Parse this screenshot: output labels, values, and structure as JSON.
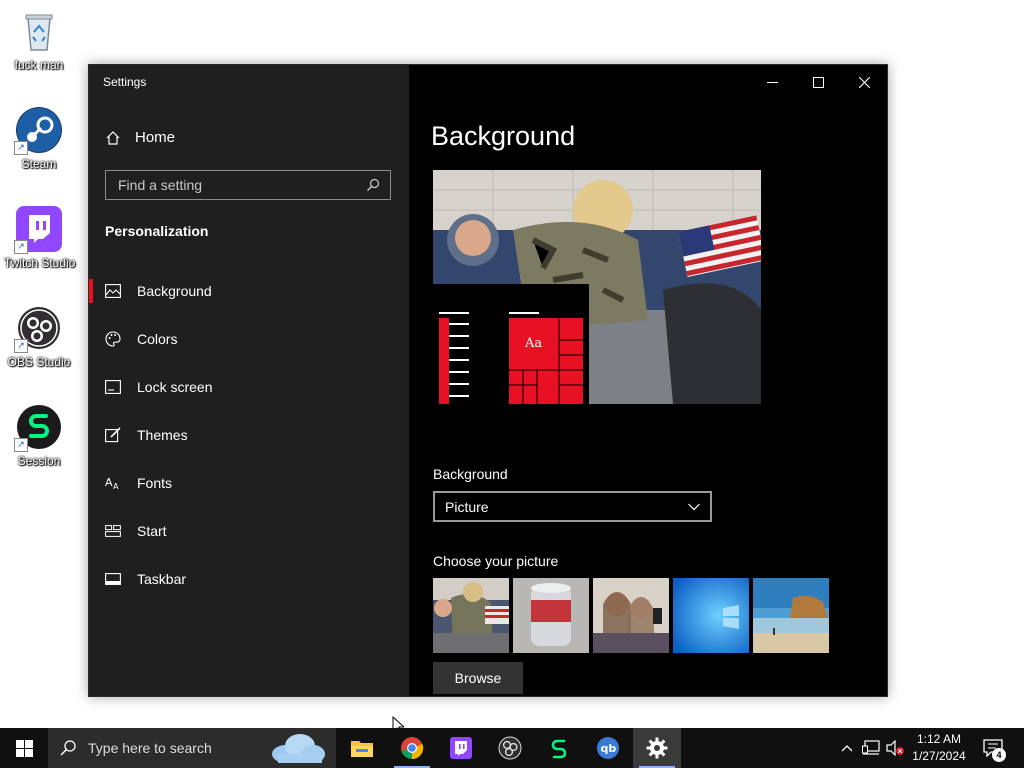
{
  "desktop": {
    "icons": [
      {
        "label": "fuck man",
        "icon": "recycle-bin-icon"
      },
      {
        "label": "Steam",
        "icon": "steam-icon"
      },
      {
        "label": "Twitch Studio",
        "icon": "twitch-studio-icon"
      },
      {
        "label": "OBS Studio",
        "icon": "obs-studio-icon"
      },
      {
        "label": "Session",
        "icon": "session-icon"
      }
    ]
  },
  "window": {
    "title": "Settings",
    "caption": {
      "minimize": "minimize-icon",
      "maximize": "maximize-icon",
      "close": "close-icon"
    }
  },
  "sidebar": {
    "home_label": "Home",
    "search_placeholder": "Find a setting",
    "section_title": "Personalization",
    "items": [
      {
        "label": "Background",
        "icon": "picture-icon",
        "active": true
      },
      {
        "label": "Colors",
        "icon": "palette-icon",
        "active": false
      },
      {
        "label": "Lock screen",
        "icon": "lock-screen-icon",
        "active": false
      },
      {
        "label": "Themes",
        "icon": "themes-icon",
        "active": false
      },
      {
        "label": "Fonts",
        "icon": "fonts-icon",
        "active": false
      },
      {
        "label": "Start",
        "icon": "start-icon",
        "active": false
      },
      {
        "label": "Taskbar",
        "icon": "taskbar-icon",
        "active": false
      }
    ]
  },
  "main": {
    "page_title": "Background",
    "preview_tile_text": "Aa",
    "background_label": "Background",
    "background_value": "Picture",
    "choose_label": "Choose your picture",
    "browse_label": "Browse"
  },
  "taskbar": {
    "search_placeholder": "Type here to search",
    "apps": [
      "file-explorer-icon",
      "chrome-icon",
      "twitch-icon",
      "obs-icon",
      "session-icon",
      "qbittorrent-icon",
      "settings-icon"
    ],
    "clock_time": "1:12 AM",
    "clock_date": "1/27/2024",
    "notification_count": "4"
  },
  "colors": {
    "accent": "#e81123",
    "sidebar_bg": "#1f1f1f",
    "content_bg": "#000000"
  }
}
